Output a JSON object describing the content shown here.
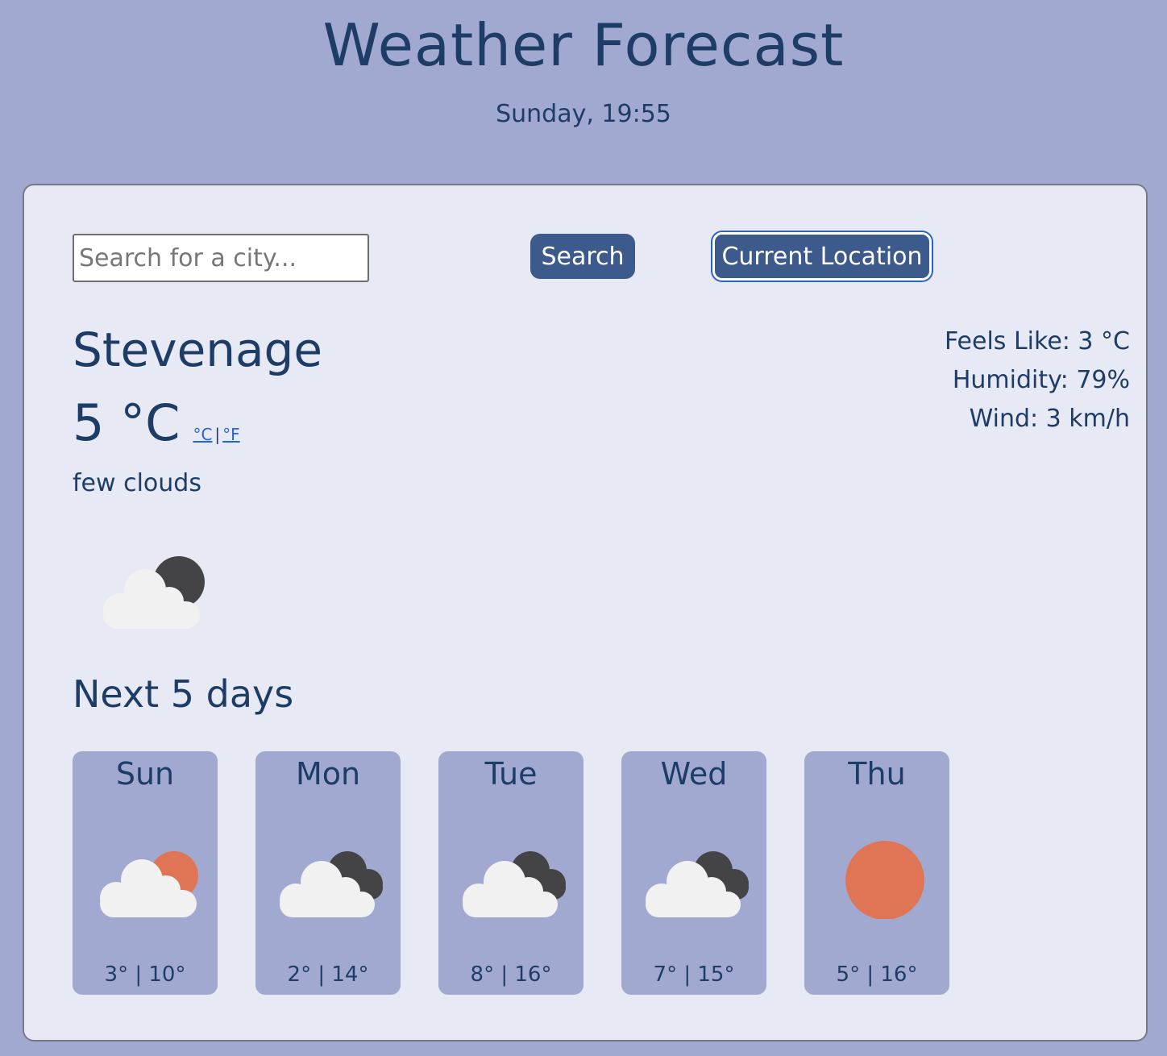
{
  "header": {
    "title": "Weather Forecast",
    "datetime": "Sunday, 19:55"
  },
  "search": {
    "placeholder": "Search for a city...",
    "value": "",
    "search_label": "Search",
    "location_label": "Current Location"
  },
  "current": {
    "city": "Stevenage",
    "temperature": "5 °C",
    "unit_c": "°C",
    "unit_separator": "|",
    "unit_f": "°F",
    "description": "few clouds",
    "icon": "few-clouds-night-icon",
    "feels_like": "Feels Like: 3 °C",
    "humidity": "Humidity: 79%",
    "wind": "Wind: 3 km/h"
  },
  "forecast": {
    "title": "Next 5 days",
    "days": [
      {
        "day": "Sun",
        "icon": "partly-cloudy-day-icon",
        "temps": "3° | 10°"
      },
      {
        "day": "Mon",
        "icon": "broken-clouds-icon",
        "temps": "2° | 14°"
      },
      {
        "day": "Tue",
        "icon": "broken-clouds-icon",
        "temps": "8° | 16°"
      },
      {
        "day": "Wed",
        "icon": "broken-clouds-icon",
        "temps": "7° | 15°"
      },
      {
        "day": "Thu",
        "icon": "clear-sky-icon",
        "temps": "5° | 16°"
      }
    ]
  },
  "colors": {
    "background": "#a1a9d1",
    "card": "#e7e9f5",
    "button": "#3c5a8c",
    "text": "#1e3d66",
    "sun": "#e07555",
    "cloud_dark": "#444446",
    "cloud_light": "#f1f1f1"
  }
}
